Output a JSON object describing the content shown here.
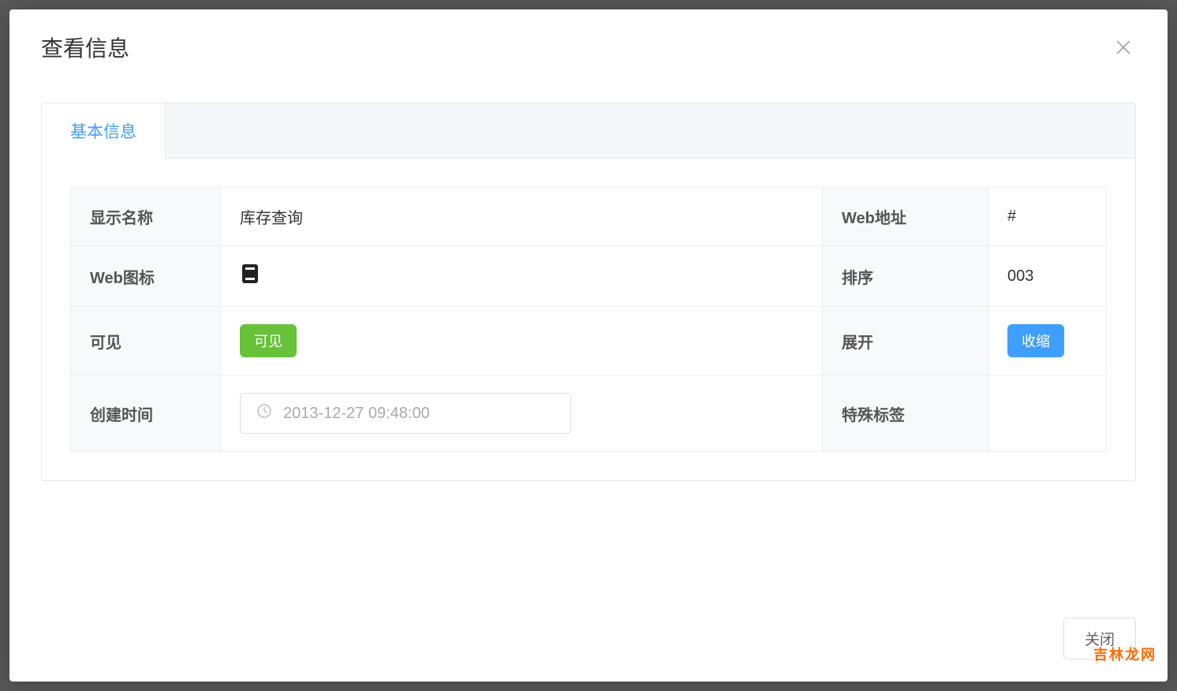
{
  "modal": {
    "title": "查看信息",
    "close_button": "关闭"
  },
  "tabs": {
    "active": "基本信息"
  },
  "fields": {
    "display_name": {
      "label": "显示名称",
      "value": "库存查询"
    },
    "web_url": {
      "label": "Web地址",
      "value": "#"
    },
    "web_icon": {
      "label": "Web图标",
      "icon_name": "book-icon"
    },
    "sort": {
      "label": "排序",
      "value": "003"
    },
    "visible": {
      "label": "可见",
      "tag": "可见"
    },
    "expand": {
      "label": "展开",
      "tag": "收缩"
    },
    "create_time": {
      "label": "创建时间",
      "value": "2013-12-27 09:48:00"
    },
    "special_tag": {
      "label": "特殊标签",
      "value": ""
    }
  },
  "watermark": "吉林龙网"
}
